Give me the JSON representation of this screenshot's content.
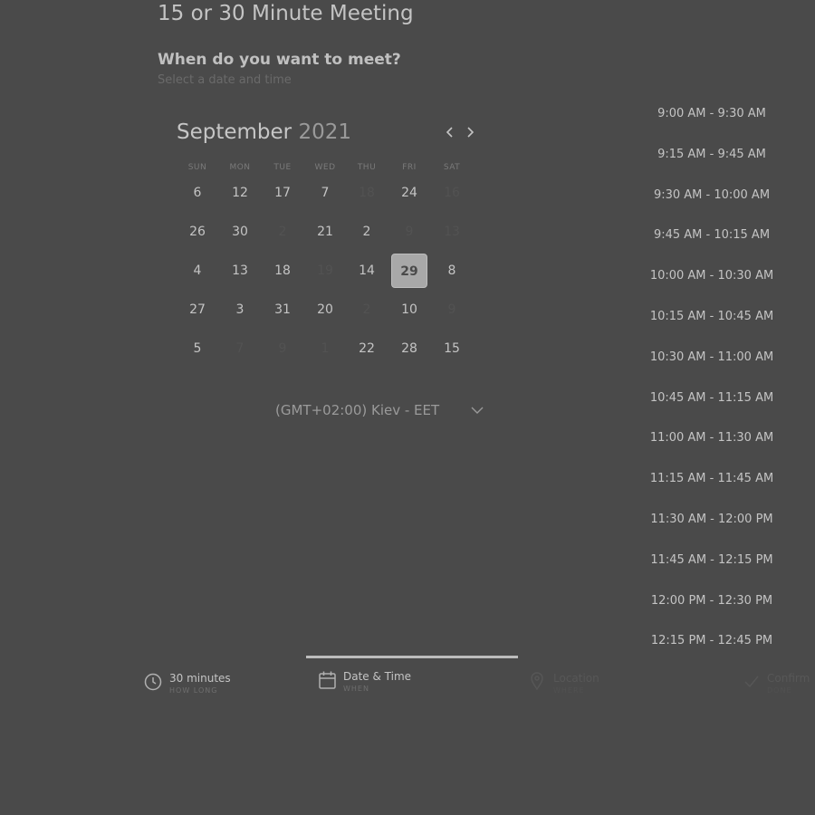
{
  "page": {
    "title": "15 or 30 Minute Meeting",
    "question": "When do you want to meet?",
    "subtitle": "Select a date and time"
  },
  "calendar": {
    "month": "September",
    "year": "2021",
    "weekdays": [
      "SUN",
      "MON",
      "TUE",
      "WED",
      "THU",
      "FRI",
      "SAT"
    ],
    "weeks": [
      [
        "6",
        "12",
        "17",
        "7",
        "18",
        "24",
        "16"
      ],
      [
        "26",
        "30",
        "2",
        "21",
        "2",
        "9",
        "13"
      ],
      [
        "4",
        "13",
        "18",
        "19",
        "14",
        "29",
        "8"
      ],
      [
        "27",
        "3",
        "31",
        "20",
        "2",
        "10",
        "9"
      ],
      [
        "5",
        "7",
        "9",
        "1",
        "22",
        "28",
        "15"
      ]
    ],
    "disabled": [
      [
        false,
        false,
        false,
        false,
        true,
        false,
        true
      ],
      [
        false,
        false,
        true,
        false,
        false,
        true,
        true
      ],
      [
        false,
        false,
        false,
        true,
        false,
        false,
        false
      ],
      [
        false,
        false,
        false,
        false,
        true,
        false,
        true
      ],
      [
        false,
        true,
        true,
        true,
        false,
        false,
        false
      ]
    ],
    "selected": {
      "week": 2,
      "day": 5
    },
    "prev_icon": "chevron-left-icon",
    "next_icon": "chevron-right-icon"
  },
  "timezone": {
    "label": "(GMT+02:00) Kiev - EET",
    "icon": "chevron-down-icon"
  },
  "time_slots": [
    "9:00 AM - 9:30 AM",
    "9:15 AM - 9:45 AM",
    "9:30 AM - 10:00 AM",
    "9:45 AM - 10:15 AM",
    "10:00 AM - 10:30 AM",
    "10:15 AM - 10:45 AM",
    "10:30 AM - 11:00 AM",
    "10:45 AM - 11:15 AM",
    "11:00 AM - 11:30 AM",
    "11:15 AM - 11:45 AM",
    "11:30 AM - 12:00 PM",
    "11:45 AM - 12:15 PM",
    "12:00 PM - 12:30 PM",
    "12:15 PM - 12:45 PM"
  ],
  "steps": [
    {
      "label": "30 minutes",
      "sub": "HOW LONG",
      "icon": "clock-icon"
    },
    {
      "label": "Date & Time",
      "sub": "WHEN",
      "icon": "calendar-icon",
      "active": true
    },
    {
      "label": "Location",
      "sub": "WHERE",
      "icon": "location-pin-icon"
    },
    {
      "label": "Confirm",
      "sub": "DONE",
      "icon": "check-icon"
    }
  ],
  "colors": {
    "background": "#4a4a4a",
    "text": "#c4c4c4",
    "selected_day": "#a8a8a8",
    "disabled": "#525252"
  }
}
